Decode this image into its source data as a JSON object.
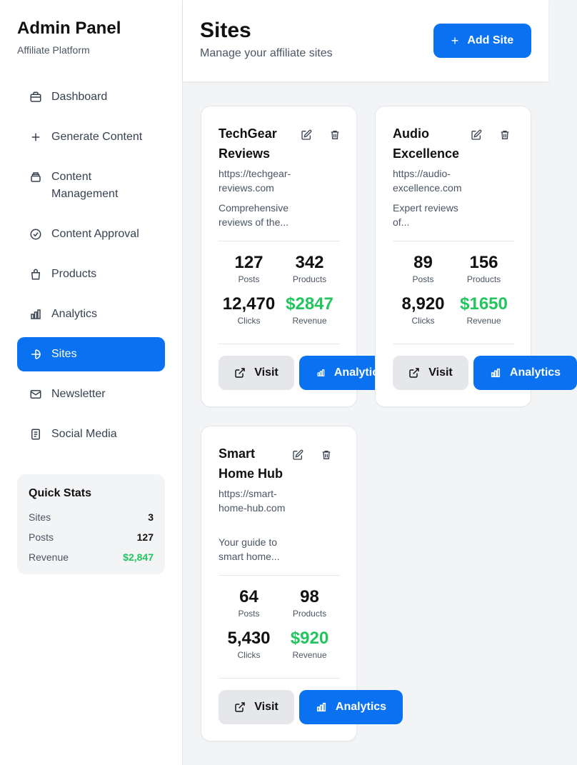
{
  "sidebar": {
    "title": "Admin Panel",
    "subtitle": "Affiliate Platform",
    "items": [
      {
        "label": "Dashboard",
        "icon": "briefcase-icon"
      },
      {
        "label": "Generate Content",
        "icon": "plus-icon"
      },
      {
        "label": "Content Management",
        "icon": "layers-icon"
      },
      {
        "label": "Content Approval",
        "icon": "check-circle-icon"
      },
      {
        "label": "Products",
        "icon": "bag-icon"
      },
      {
        "label": "Analytics",
        "icon": "bar-chart-icon"
      },
      {
        "label": "Sites",
        "icon": "globe-icon"
      },
      {
        "label": "Newsletter",
        "icon": "mail-icon"
      },
      {
        "label": "Social Media",
        "icon": "document-icon"
      }
    ],
    "active_item": "Sites",
    "quick_stats": {
      "title": "Quick Stats",
      "rows": [
        {
          "label": "Sites",
          "value": "3"
        },
        {
          "label": "Posts",
          "value": "127"
        },
        {
          "label": "Revenue",
          "value": "$2,847"
        }
      ]
    }
  },
  "header": {
    "title": "Sites",
    "subtitle": "Manage your affiliate sites",
    "add_button": "Add Site"
  },
  "sites": [
    {
      "name": "TechGear Reviews",
      "url": "https://techgear-reviews.com",
      "description": "Comprehensive reviews of the...",
      "posts": "127",
      "posts_label": "Posts",
      "products": "342",
      "products_label": "Products",
      "clicks": "12,470",
      "clicks_label": "Clicks",
      "revenue": "$2847",
      "revenue_label": "Revenue",
      "visit_label": "Visit",
      "analytics_label": "Analytics"
    },
    {
      "name": "Audio Excellence",
      "url": "https://audio-excellence.com",
      "description": "Expert reviews of...",
      "posts": "89",
      "posts_label": "Posts",
      "products": "156",
      "products_label": "Products",
      "clicks": "8,920",
      "clicks_label": "Clicks",
      "revenue": "$1650",
      "revenue_label": "Revenue",
      "visit_label": "Visit",
      "analytics_label": "Analytics"
    },
    {
      "name": "Smart Home Hub",
      "url": "https://smart-home-hub.com",
      "description": "Your guide to smart home...",
      "posts": "64",
      "posts_label": "Posts",
      "products": "98",
      "products_label": "Products",
      "clicks": "5,430",
      "clicks_label": "Clicks",
      "revenue": "$920",
      "revenue_label": "Revenue",
      "visit_label": "Visit",
      "analytics_label": "Analytics"
    }
  ],
  "colors": {
    "accent": "#0a72f0",
    "revenue_green": "#22c55e"
  }
}
